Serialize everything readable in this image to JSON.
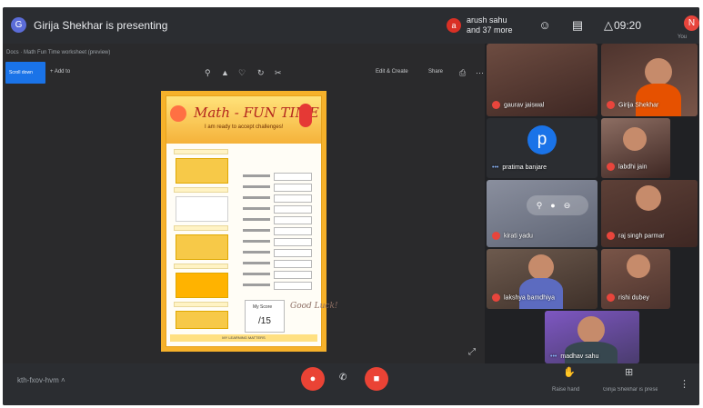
{
  "header": {
    "presenter_initial": "G",
    "presenting_title": "Girija Shekhar is presenting",
    "participants_initial": "a",
    "participants_line1": "arush sahu",
    "participants_line2": "and 37 more",
    "clock": "09:20",
    "me_initial": "N",
    "me_label": "You",
    "icons": [
      "people-icon",
      "chat-icon",
      "activities-icon"
    ]
  },
  "presentation": {
    "path_text": "Docs · Math Fun Time worksheet (preview)",
    "blue_button_label": "Scroll down",
    "add_button_label": "Add to",
    "tools_right": [
      "Edit & Create",
      "Share"
    ],
    "worksheet": {
      "title": "Math - FUN TIME",
      "subtitle_prefix": "I am ready to accept challenges!",
      "score_label": "My Score",
      "score_value": "/15",
      "good_luck": "Good Luck!",
      "footer": "MY LEARNING MATTERS"
    }
  },
  "tiles": [
    {
      "name": "gaurav jaiswal",
      "type": "video",
      "indicator": "mic-off"
    },
    {
      "name": "Girija Shekhar",
      "type": "video",
      "indicator": "mic-off"
    },
    {
      "name": "pratima banjare",
      "type": "avatar",
      "initial": "p",
      "indicator": "speaking"
    },
    {
      "name": "labdhi jain",
      "type": "video",
      "indicator": "mic-off"
    },
    {
      "name": "kirati yadu",
      "type": "video",
      "indicator": "mic-off"
    },
    {
      "name": "raj singh parmar",
      "type": "video",
      "indicator": "mic-off"
    },
    {
      "name": "lakshya bamdhiya",
      "type": "video",
      "indicator": "mic-off"
    },
    {
      "name": "rishi dubey",
      "type": "video",
      "indicator": "mic-off"
    },
    {
      "name": "madhav sahu",
      "type": "video",
      "indicator": "speaking"
    }
  ],
  "footer": {
    "meeting_code": "kth-fxov-hvm",
    "raise_hand_label": "Raise hand",
    "present_label": "Girija Shekhar is presenting"
  },
  "colors": {
    "background": "#202124",
    "bar": "#2b2d31",
    "accent": "#1a73e8",
    "danger": "#ea4335",
    "worksheet_border": "#f6b12a"
  }
}
